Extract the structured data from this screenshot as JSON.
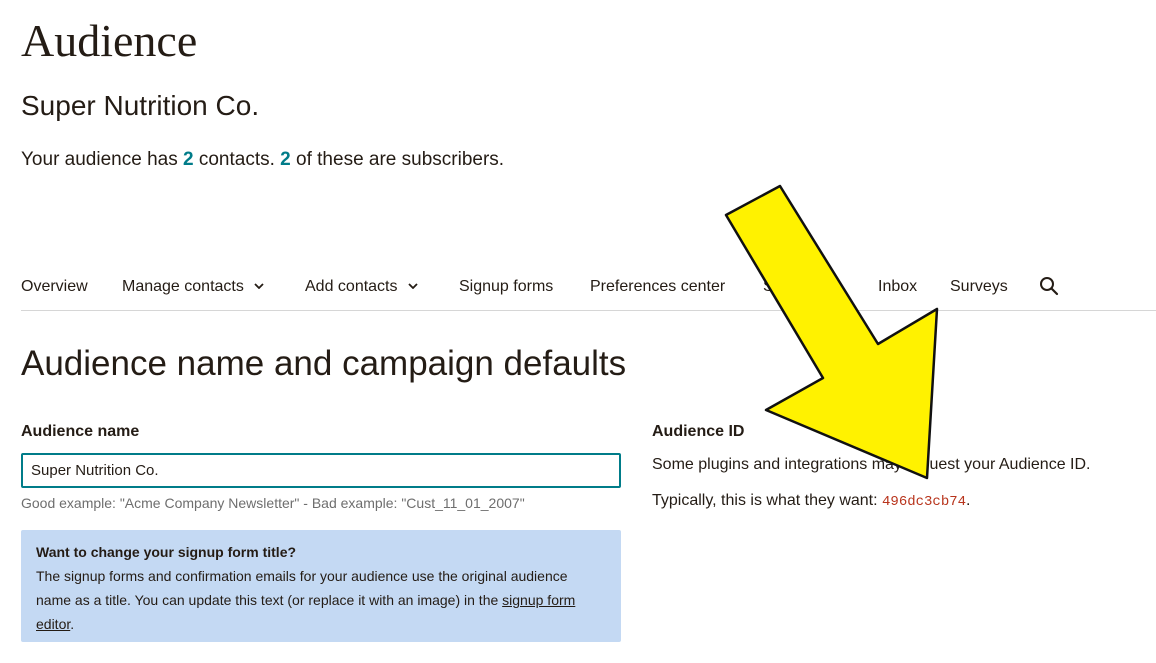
{
  "header": {
    "title": "Audience",
    "audience_name": "Super Nutrition Co.",
    "summary": {
      "prefix": "Your audience has ",
      "contacts_count": "2",
      "middle": " contacts. ",
      "subscribers_count": "2",
      "suffix": " of these are subscribers."
    }
  },
  "nav": {
    "items": [
      {
        "label": "Overview"
      },
      {
        "label": "Manage contacts"
      },
      {
        "label": "Add contacts"
      },
      {
        "label": "Signup forms"
      },
      {
        "label": "Preferences center"
      },
      {
        "label": "Settings"
      },
      {
        "label": "Inbox"
      },
      {
        "label": "Surveys"
      }
    ],
    "search_icon": "search-icon"
  },
  "section": {
    "title": "Audience name and campaign defaults"
  },
  "form": {
    "audience_name_label": "Audience name",
    "audience_name_value": "Super Nutrition Co.",
    "helper": "Good example: \"Acme Company Newsletter\" - Bad example: \"Cust_11_01_2007\""
  },
  "info_box": {
    "title": "Want to change your signup form title?",
    "body": "The signup forms and confirmation emails for your audience use the original audience name as a title. You can update this text (or replace it with an image) in the ",
    "link_text": "signup form editor",
    "suffix": "."
  },
  "audience_id": {
    "label": "Audience ID",
    "description": "Some plugins and integrations may request your Audience ID.",
    "typical_prefix": "Typically, this is what they want: ",
    "value": "496dc3cb74",
    "typical_suffix": "."
  },
  "colors": {
    "accent": "#007c89",
    "info_bg": "#c4d9f3",
    "id_value": "#b8341c",
    "annotation_arrow": "#fff200"
  }
}
